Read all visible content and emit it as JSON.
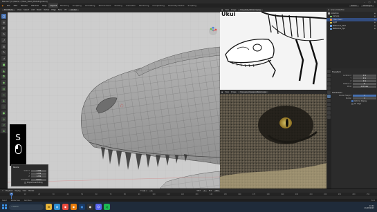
{
  "window": {
    "title": "Blender* [C:\\Users\\...\\T-Rex_Head_Modeling.blend]",
    "controls": [
      "–",
      "□",
      "✕"
    ]
  },
  "menubar": {
    "menus": [
      "File",
      "Edit",
      "Render",
      "Window",
      "Help"
    ],
    "workspaces": [
      "Layout",
      "Modeling",
      "Sculpting",
      "UV Editing",
      "Texture Paint",
      "Shading",
      "Animation",
      "Rendering",
      "Compositing",
      "Geometry Nodes",
      "Scripting"
    ],
    "active_workspace": "Layout",
    "scene": "Scene",
    "view_layer": "ViewLayer"
  },
  "viewport_header": {
    "mode": "Edit Mode",
    "items": [
      "View",
      "Select",
      "Add",
      "Mesh",
      "Vertex",
      "Edge",
      "Face",
      "UV"
    ],
    "orientation": "Global"
  },
  "toolbar": {
    "tools": [
      "select-box-icon",
      "cursor-icon",
      "move-icon",
      "rotate-icon",
      "scale-icon",
      "transform-icon",
      "annotate-icon",
      "measure-icon",
      "add-cube-icon",
      "extrude-icon",
      "inset-icon",
      "bevel-icon",
      "loopcut-icon",
      "knife-icon",
      "polybuild-icon",
      "spin-icon",
      "smooth-icon",
      "shrink-icon",
      "shear-icon",
      "rip-icon"
    ]
  },
  "keycast": {
    "key": "S"
  },
  "last_operator": {
    "title": "Resize",
    "fields": [
      {
        "label": "Scale X",
        "value": "0.789"
      },
      {
        "label": "Y",
        "value": "0.789"
      },
      {
        "label": "Z",
        "value": "0.789"
      }
    ],
    "orientation_label": "Orientation",
    "orientation_value": "Global",
    "options": [
      "Proportional Editing"
    ]
  },
  "ref_top": {
    "title": "trex_skull_reference.png",
    "items": [
      "View",
      "Image"
    ]
  },
  "ref_bot": {
    "title": "trex_eye_closeup_reference.jpg",
    "items": [
      "View",
      "Image"
    ]
  },
  "outliner": {
    "title": "Scene Collection",
    "rows": [
      {
        "name": "Collection",
        "color": "#b0b0b0",
        "sel": false
      },
      {
        "name": "Camera",
        "color": "#7ec86a",
        "sel": false
      },
      {
        "name": "T-Rex Head",
        "color": "#e88a3c",
        "sel": true
      },
      {
        "name": "Light",
        "color": "#e0c84a",
        "sel": false
      },
      {
        "name": "Reference_Skull",
        "color": "#6aa4e8",
        "sel": false
      },
      {
        "name": "Reference_Eye",
        "color": "#6aa4e8",
        "sel": false
      }
    ]
  },
  "properties": {
    "section1": "Transform",
    "fields1": [
      {
        "label": "Location X",
        "value": "0 m"
      },
      {
        "label": "Y",
        "value": "0 m"
      },
      {
        "label": "Z",
        "value": "0 m"
      },
      {
        "label": "Rotation X",
        "value": "0°"
      },
      {
        "label": "Mode",
        "value": "XYZ Euler"
      }
    ],
    "section2": "Subdivision",
    "fields2": [
      {
        "label": "Levels Viewport",
        "value": "2"
      },
      {
        "label": "Render",
        "value": "2"
      }
    ],
    "checks": [
      {
        "label": "Optimal Display",
        "on": true
      },
      {
        "label": "On Cage",
        "on": false
      }
    ]
  },
  "timeline": {
    "items": [
      "Playback",
      "Keying",
      "View",
      "Marker"
    ],
    "current_frame": "1",
    "start_label": "Start",
    "start": "1",
    "end_label": "End",
    "end": "250",
    "ticks": [
      "0",
      "10",
      "20",
      "30",
      "40",
      "50",
      "60",
      "70",
      "80",
      "90",
      "100",
      "110",
      "120",
      "130",
      "140",
      "150",
      "160",
      "170",
      "180",
      "190",
      "200",
      "210",
      "220",
      "230",
      "240",
      "250"
    ]
  },
  "statusbar": {
    "hints": [
      "Select",
      "Rotate View",
      "Call Menu"
    ],
    "version": "3.6.1"
  },
  "taskbar": {
    "search_placeholder": "Search",
    "time": "10:42",
    "date": "21/08/2023"
  }
}
